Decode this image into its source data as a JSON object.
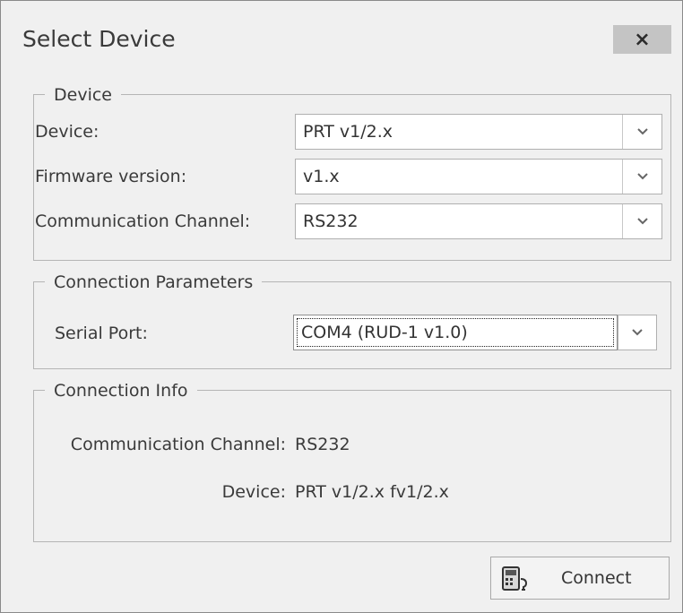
{
  "window": {
    "title": "Select Device",
    "close_symbol": "×"
  },
  "device_group": {
    "legend": "Device",
    "device_label": "Device:",
    "device_value": "PRT v1/2.x",
    "firmware_label": "Firmware version:",
    "firmware_value": "v1.x",
    "channel_label": "Communication Channel:",
    "channel_value": "RS232"
  },
  "connection_params": {
    "legend": "Connection Parameters",
    "serial_port_label": "Serial Port:",
    "serial_port_value": "COM4 (RUD-1 v1.0)"
  },
  "connection_info": {
    "legend": "Connection Info",
    "channel_label": "Communication Channel:",
    "channel_value": "RS232",
    "device_label": "Device:",
    "device_value": "PRT v1/2.x fv1/2.x"
  },
  "footer": {
    "connect_label": "Connect"
  },
  "icons": {
    "close": "close-icon",
    "dropdown": "chevron-down-icon",
    "connect": "device-connect-icon"
  },
  "colors": {
    "background": "#f0f0f0",
    "close_button": "#c4c4c4",
    "border": "#b5b5b5"
  }
}
